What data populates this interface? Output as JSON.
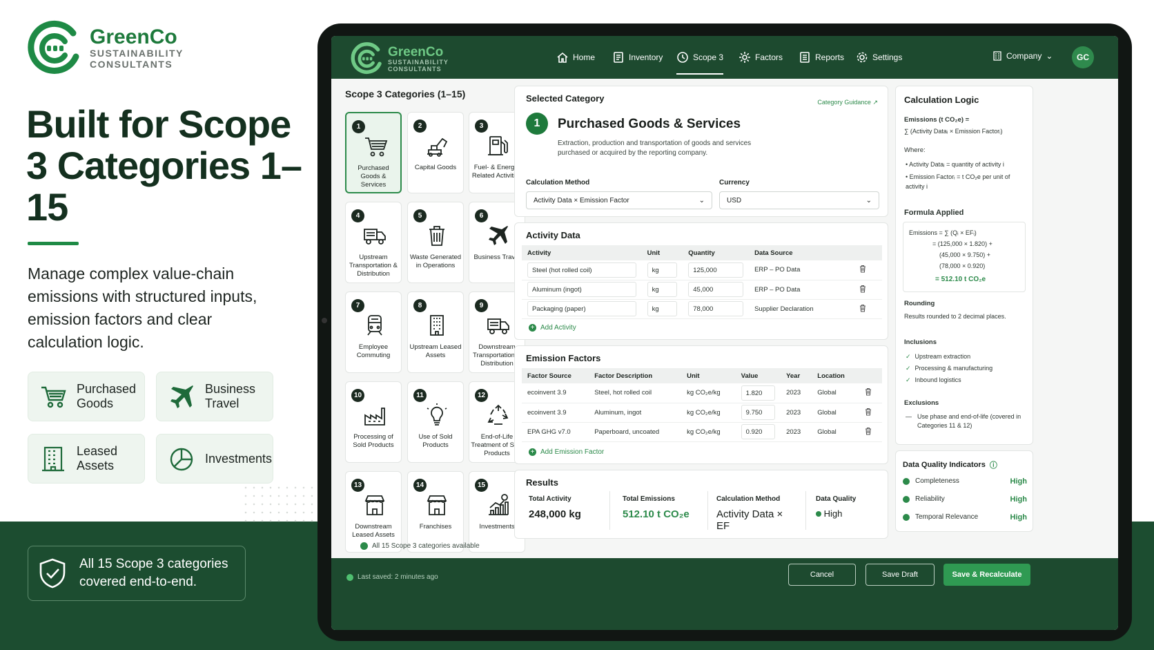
{
  "brand": {
    "name": "GreenCo",
    "sub1": "SUSTAINABILITY",
    "sub2": "CONSULTANTS"
  },
  "hero": {
    "headline": "Built for Scope 3 Categories 1–15",
    "description": "Manage complex value-chain emissions with structured inputs, emission factors and clear calculation logic."
  },
  "features": [
    {
      "label": "Purchased Goods",
      "icon": "cart-icon"
    },
    {
      "label": "Business Travel",
      "icon": "airplane-icon"
    },
    {
      "label": "Leased Assets",
      "icon": "building-icon"
    },
    {
      "label": "Investments",
      "icon": "pie-chart-icon"
    }
  ],
  "coverage": "All 15 Scope 3 categories covered end-to-end.",
  "nav": {
    "items": [
      "Home",
      "Inventory",
      "Scope 3",
      "Factors",
      "Reports",
      "Settings"
    ],
    "active": "Scope 3",
    "company": "Company",
    "avatar": "GC"
  },
  "categories": {
    "title": "Scope 3 Categories (1–15)",
    "footer": "All 15 Scope 3 categories available",
    "items": [
      {
        "n": "1",
        "label": "Purchased Goods & Services",
        "icon": "cart-icon"
      },
      {
        "n": "2",
        "label": "Capital Goods",
        "icon": "excavator-icon"
      },
      {
        "n": "3",
        "label": "Fuel- & Energy-Related Activities",
        "icon": "fuel-pump-icon"
      },
      {
        "n": "4",
        "label": "Upstream Transportation & Distribution",
        "icon": "truck-icon"
      },
      {
        "n": "5",
        "label": "Waste Generated in Operations",
        "icon": "trash-icon"
      },
      {
        "n": "6",
        "label": "Business Travel",
        "icon": "airplane-icon"
      },
      {
        "n": "7",
        "label": "Employee Commuting",
        "icon": "train-icon"
      },
      {
        "n": "8",
        "label": "Upstream Leased Assets",
        "icon": "building-icon"
      },
      {
        "n": "9",
        "label": "Downstream Transportation & Distribution",
        "icon": "truck-icon"
      },
      {
        "n": "10",
        "label": "Processing of Sold Products",
        "icon": "factory-icon"
      },
      {
        "n": "11",
        "label": "Use of Sold Products",
        "icon": "lightbulb-icon"
      },
      {
        "n": "12",
        "label": "End-of-Life Treatment of Sold Products",
        "icon": "recycle-icon"
      },
      {
        "n": "13",
        "label": "Downstream Leased Assets",
        "icon": "store-icon"
      },
      {
        "n": "14",
        "label": "Franchises",
        "icon": "store-icon"
      },
      {
        "n": "15",
        "label": "Investments",
        "icon": "growth-chart-icon"
      }
    ]
  },
  "selected": {
    "heading": "Selected Category",
    "guidance": "Category Guidance",
    "num": "1",
    "title": "Purchased Goods & Services",
    "desc": "Extraction, production and transportation of goods and services purchased or acquired by the reporting company.",
    "method_label": "Calculation Method",
    "method": "Activity Data × Emission Factor",
    "currency_label": "Currency",
    "currency": "USD"
  },
  "activity": {
    "title": "Activity Data",
    "headers": [
      "Activity",
      "Unit",
      "Quantity",
      "Data Source"
    ],
    "rows": [
      [
        "Steel (hot rolled coil)",
        "kg",
        "125,000",
        "ERP – PO Data"
      ],
      [
        "Aluminum (ingot)",
        "kg",
        "45,000",
        "ERP – PO Data"
      ],
      [
        "Packaging (paper)",
        "kg",
        "78,000",
        "Supplier Declaration"
      ]
    ],
    "add": "Add Activity"
  },
  "factors": {
    "title": "Emission Factors",
    "headers": [
      "Factor Source",
      "Factor Description",
      "Unit",
      "Value",
      "Year",
      "Location"
    ],
    "rows": [
      [
        "ecoinvent 3.9",
        "Steel, hot rolled coil",
        "kg CO₂e/kg",
        "1.820",
        "2023",
        "Global"
      ],
      [
        "ecoinvent 3.9",
        "Aluminum, ingot",
        "kg CO₂e/kg",
        "9.750",
        "2023",
        "Global"
      ],
      [
        "EPA GHG v7.0",
        "Paperboard, uncoated",
        "kg CO₂e/kg",
        "0.920",
        "2023",
        "Global"
      ]
    ],
    "add": "Add Emission Factor"
  },
  "results": {
    "title": "Results",
    "total_activity_label": "Total Activity",
    "total_activity": "248,000 kg",
    "total_emissions_label": "Total Emissions",
    "total_emissions": "512.10 t CO₂e",
    "method_label": "Calculation Method",
    "method": "Activity Data × EF",
    "quality_label": "Data Quality",
    "quality": "High"
  },
  "logic": {
    "title": "Calculation Logic",
    "formula1": "Emissions (t CO₂e) =",
    "formula2": "∑ (Activity Dataᵢ × Emission Factorᵢ)",
    "where": "Where:",
    "w1": "Activity Dataᵢ = quantity of activity i",
    "w2": "Emission Factorᵢ = t CO₂e per unit of activity i",
    "applied_title": "Formula Applied",
    "applied": [
      "Emissions = ∑ (Qᵢ × EFᵢ)",
      "= (125,000 × 1.820) +",
      "(45,000 × 9.750) +",
      "(78,000 × 0.920)",
      "= 512.10 t CO₂e"
    ],
    "rounding_title": "Rounding",
    "rounding": "Results rounded to 2 decimal places.",
    "inclusions_title": "Inclusions",
    "inclusions": [
      "Upstream extraction",
      "Processing & manufacturing",
      "Inbound logistics"
    ],
    "exclusions_title": "Exclusions",
    "exclusion": "Use phase and end-of-life (covered in Categories 11 & 12)"
  },
  "dq": {
    "title": "Data Quality Indicators",
    "rows": [
      [
        "Completeness",
        "High"
      ],
      [
        "Reliability",
        "High"
      ],
      [
        "Temporal Relevance",
        "High"
      ]
    ]
  },
  "footer": {
    "saved": "Last saved: 2 minutes ago",
    "cancel": "Cancel",
    "draft": "Save Draft",
    "save": "Save & Recalculate"
  },
  "colors": {
    "brand_dark": "#1d4a2f",
    "brand_green": "#2c8a4a"
  }
}
